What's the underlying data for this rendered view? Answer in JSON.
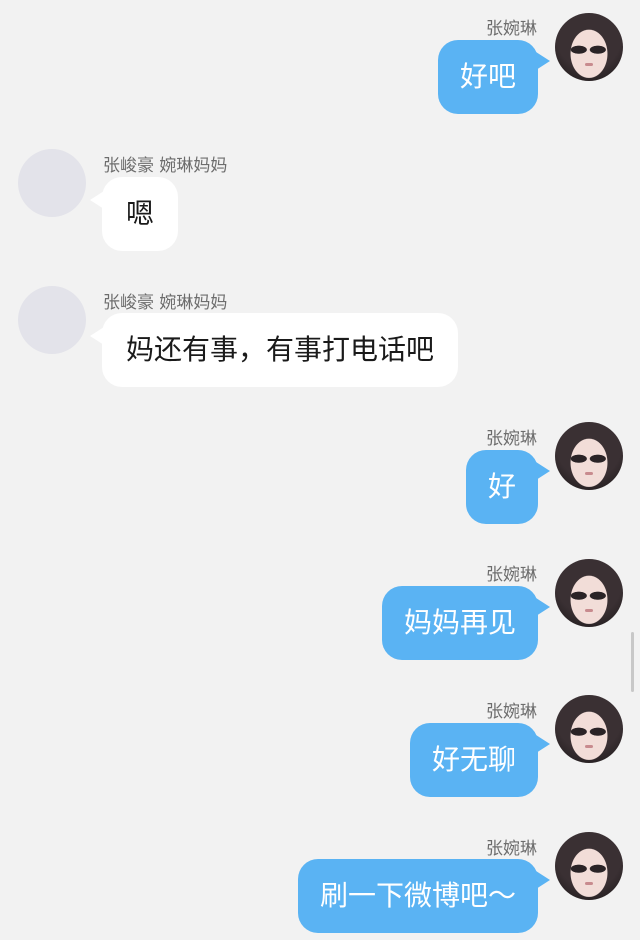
{
  "messages": [
    {
      "sender": "张婉琳",
      "text": "好吧"
    },
    {
      "sender": "张峻豪 婉琳妈妈",
      "text": "嗯"
    },
    {
      "sender": "张峻豪 婉琳妈妈",
      "text": "妈还有事，有事打电话吧"
    },
    {
      "sender": "张婉琳",
      "text": "好"
    },
    {
      "sender": "张婉琳",
      "text": "妈妈再见"
    },
    {
      "sender": "张婉琳",
      "text": "好无聊"
    },
    {
      "sender": "张婉琳",
      "text": "刷一下微博吧～"
    }
  ],
  "colors": {
    "background": "#f2f2f2",
    "my_bubble": "#5ab3f3",
    "their_bubble": "#ffffff",
    "placeholder_avatar": "#e3e3ea"
  },
  "icons": {
    "my_avatar": "user-photo-avatar",
    "their_avatar": "placeholder-avatar"
  }
}
